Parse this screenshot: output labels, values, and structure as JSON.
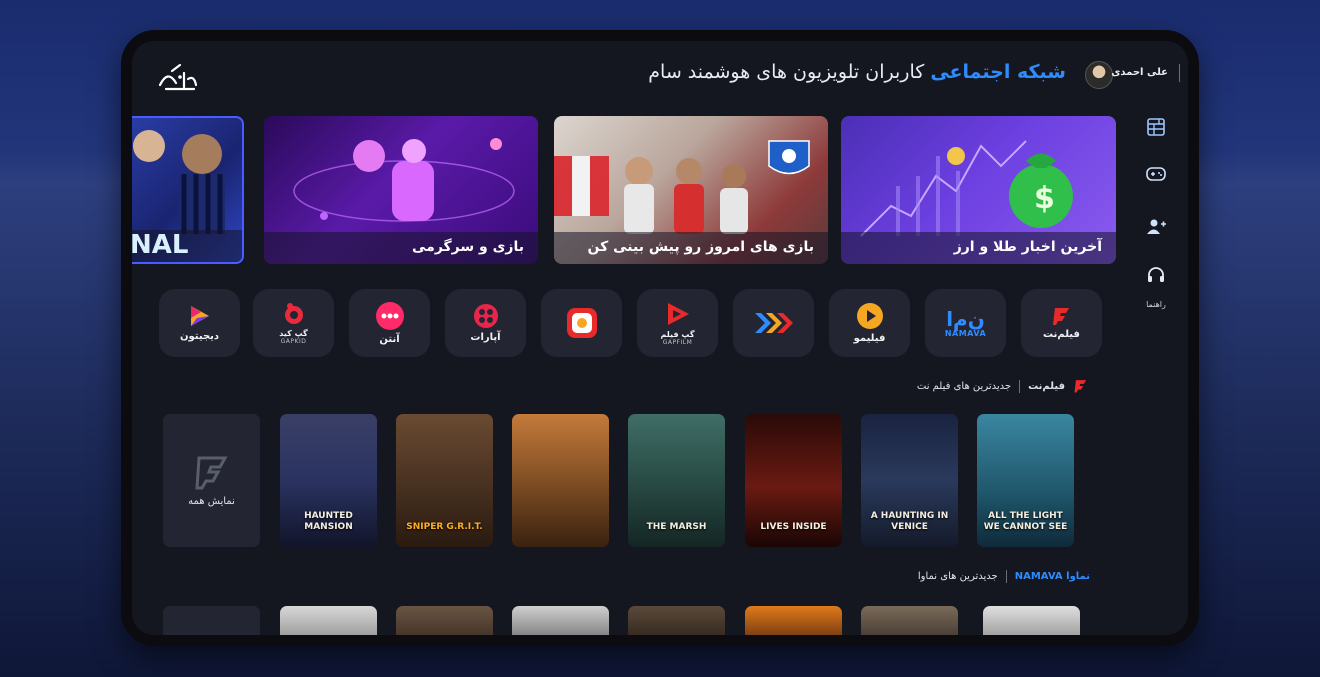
{
  "header": {
    "title_accent": "شبکه اجتماعی",
    "title_rest": "کاربران تلویزیون های هوشمند سام",
    "username": "علی احمدی"
  },
  "sidebar": {
    "items": [
      {
        "icon": "grid-icon"
      },
      {
        "icon": "gamepad-icon"
      },
      {
        "icon": "add-user-icon"
      },
      {
        "icon": "headset-icon",
        "label": "راهنما"
      }
    ]
  },
  "banners": [
    {
      "caption": "آخرین اخبار طلا و ارز"
    },
    {
      "caption": "بازی های امروز رو پیش بینی کن"
    },
    {
      "caption": "بازی و سرگرمی"
    },
    {
      "caption": "NAL"
    }
  ],
  "apps": [
    {
      "name": "فیلم‌نت",
      "sub": ""
    },
    {
      "name": "نماوا",
      "sub": "NAMAVA"
    },
    {
      "name": "فیلیمو",
      "sub": ""
    },
    {
      "name": "",
      "sub": ""
    },
    {
      "name": "گپ فیلم",
      "sub": "GAPFILM"
    },
    {
      "name": "",
      "sub": ""
    },
    {
      "name": "آپارات",
      "sub": ""
    },
    {
      "name": "آنتن",
      "sub": ""
    },
    {
      "name": "گپ کید",
      "sub": "GAPKID"
    },
    {
      "name": "دیجیتون",
      "sub": ""
    }
  ],
  "sections": [
    {
      "brand": "فیلم‌نت",
      "title": "جدیدترین های فیلم نت"
    },
    {
      "brand": "نماوا NAMAVA",
      "title": "جدیدترین های نماوا"
    }
  ],
  "posters": [
    {
      "title": "ALL THE LIGHT WE CANNOT SEE",
      "color": "#2c6f86"
    },
    {
      "title": "A HAUNTING IN VENICE",
      "color": "#2a3a5c"
    },
    {
      "title": "LIVES INSIDE",
      "color": "#5a1a14"
    },
    {
      "title": "THE MARSH",
      "color": "#2f5a54"
    },
    {
      "title": "",
      "color": "#7a4a22"
    },
    {
      "title": "SNIPER G.R.I.T.",
      "color": "#4a3322"
    },
    {
      "title": "HAUNTED MANSION",
      "color": "#2a3360"
    }
  ],
  "show_all": "نمایش همه"
}
